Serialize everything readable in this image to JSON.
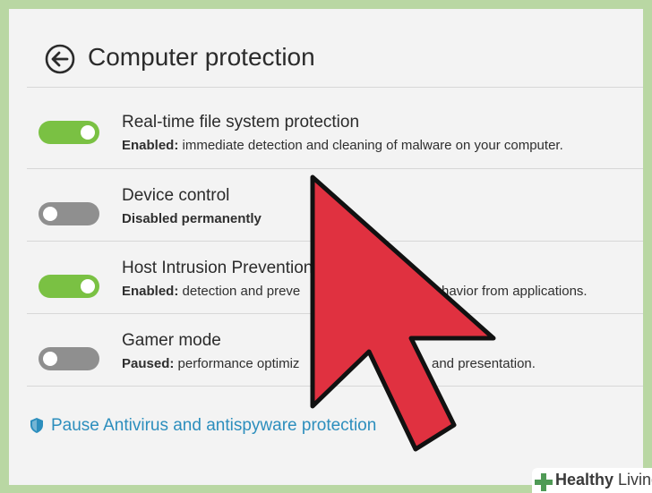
{
  "header": {
    "title": "Computer protection"
  },
  "rows": [
    {
      "title": "Real-time file system protection",
      "status_label": "Enabled:",
      "status_text": " immediate detection and cleaning of malware on your computer.",
      "toggle_state": "on"
    },
    {
      "title": "Device control",
      "status_label": "Disabled permanently",
      "status_text": "",
      "toggle_state": "off"
    },
    {
      "title": "Host Intrusion Prevention",
      "status_label": "Enabled:",
      "status_text": " detection and preve",
      "status_text_tail": "havior from applications.",
      "toggle_state": "on"
    },
    {
      "title": "Gamer mode",
      "status_label": "Paused:",
      "status_text": " performance optimiz",
      "status_text_tail": "and presentation.",
      "toggle_state": "off"
    }
  ],
  "pause_link": {
    "label": "Pause Antivirus and antispyware protection",
    "icon": "shield-icon"
  },
  "watermark": {
    "brand_bold": "Healthy",
    "brand_light": " Living"
  },
  "colors": {
    "toggle_on": "#7ac143",
    "toggle_off": "#8f8f8f",
    "link": "#2c8ebd",
    "pointer_arrow": "#e03140",
    "background": "#b9d7a3"
  }
}
